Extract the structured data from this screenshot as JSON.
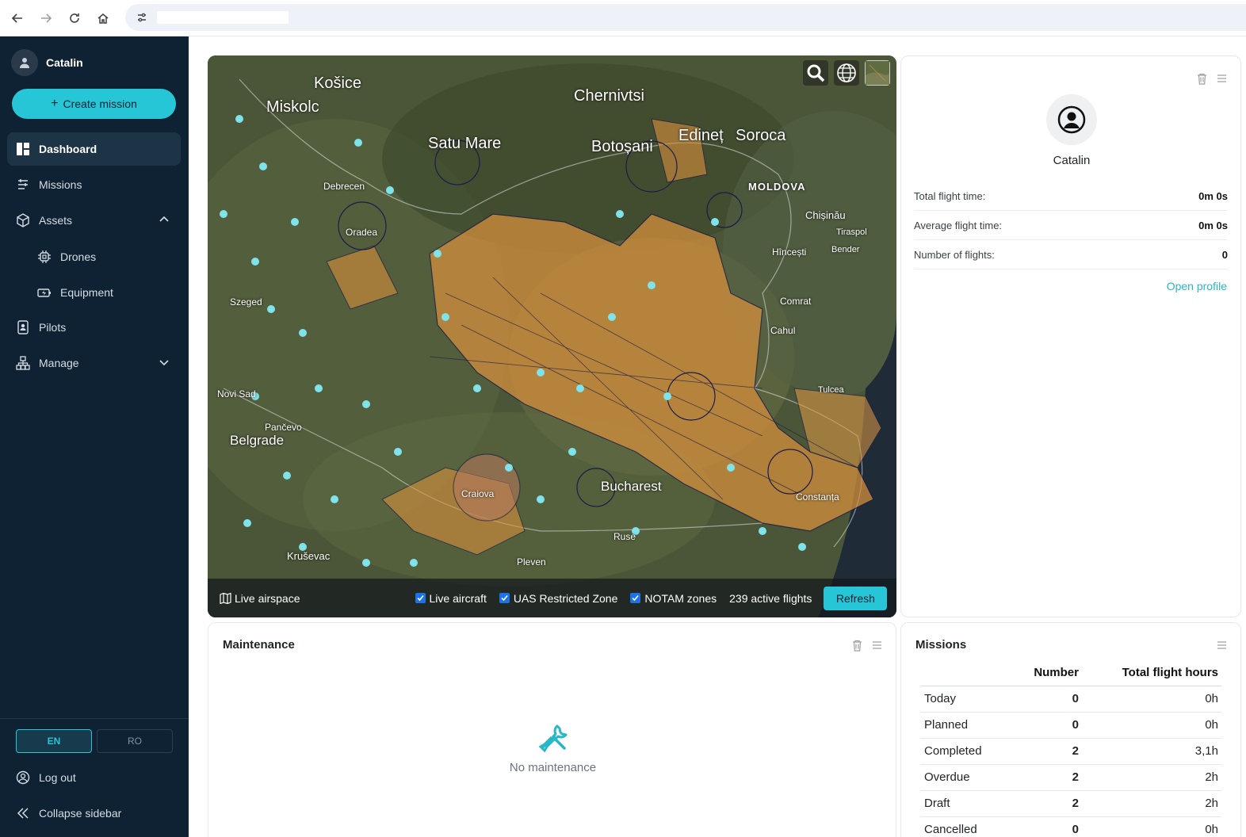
{
  "sidebar": {
    "user_name": "Catalin",
    "create_label": "Create mission",
    "items": [
      {
        "label": "Dashboard"
      },
      {
        "label": "Missions"
      },
      {
        "label": "Assets"
      },
      {
        "label": "Drones"
      },
      {
        "label": "Equipment"
      },
      {
        "label": "Pilots"
      },
      {
        "label": "Manage"
      }
    ],
    "lang_en": "EN",
    "lang_ro": "RO",
    "logout_label": "Log out",
    "collapse_label": "Collapse sidebar",
    "accent_color": "#27c6d6"
  },
  "map": {
    "places": [
      {
        "label": "Košice"
      },
      {
        "label": "Miskolc"
      },
      {
        "label": "Chernivtsi"
      },
      {
        "label": "Satu Mare"
      },
      {
        "label": "Botoșani"
      },
      {
        "label": "Edineț"
      },
      {
        "label": "Soroca"
      },
      {
        "label": "MOLDOVA"
      },
      {
        "label": "Chișinău"
      },
      {
        "label": "Debrecen"
      },
      {
        "label": "Oradea"
      },
      {
        "label": "Hîncești"
      },
      {
        "label": "Tiraspol"
      },
      {
        "label": "Bender"
      },
      {
        "label": "Comrat"
      },
      {
        "label": "Cahul"
      },
      {
        "label": "Szeged"
      },
      {
        "label": "Novi Sad"
      },
      {
        "label": "Belgrade"
      },
      {
        "label": "Pančevo"
      },
      {
        "label": "Craiova"
      },
      {
        "label": "Bucharest"
      },
      {
        "label": "Ruse"
      },
      {
        "label": "Pleven"
      },
      {
        "label": "Kruševac"
      },
      {
        "label": "Constanța"
      },
      {
        "label": "Tulcea"
      }
    ],
    "bar": {
      "live_airspace": "Live airspace",
      "live_aircraft": "Live aircraft",
      "uas_zone": "UAS Restricted Zone",
      "notam_zones": "NOTAM zones",
      "active_flights": "239 active flights",
      "refresh_label": "Refresh"
    }
  },
  "profile": {
    "name": "Catalin",
    "stats": [
      {
        "label": "Total flight time:",
        "value": "0m 0s"
      },
      {
        "label": "Average flight time:",
        "value": "0m 0s"
      },
      {
        "label": "Number of flights:",
        "value": "0"
      }
    ],
    "open_profile": "Open profile"
  },
  "maintenance": {
    "title": "Maintenance",
    "empty_text": "No maintenance"
  },
  "missions": {
    "title": "Missions",
    "headers": [
      "",
      "Number",
      "Total flight hours"
    ],
    "rows": [
      {
        "name": "Today",
        "number": "0",
        "hours": "0h"
      },
      {
        "name": "Planned",
        "number": "0",
        "hours": "0h"
      },
      {
        "name": "Completed",
        "number": "2",
        "hours": "3,1h"
      },
      {
        "name": "Overdue",
        "number": "2",
        "hours": "2h"
      },
      {
        "name": "Draft",
        "number": "2",
        "hours": "2h"
      },
      {
        "name": "Cancelled",
        "number": "0",
        "hours": "0h"
      }
    ]
  }
}
